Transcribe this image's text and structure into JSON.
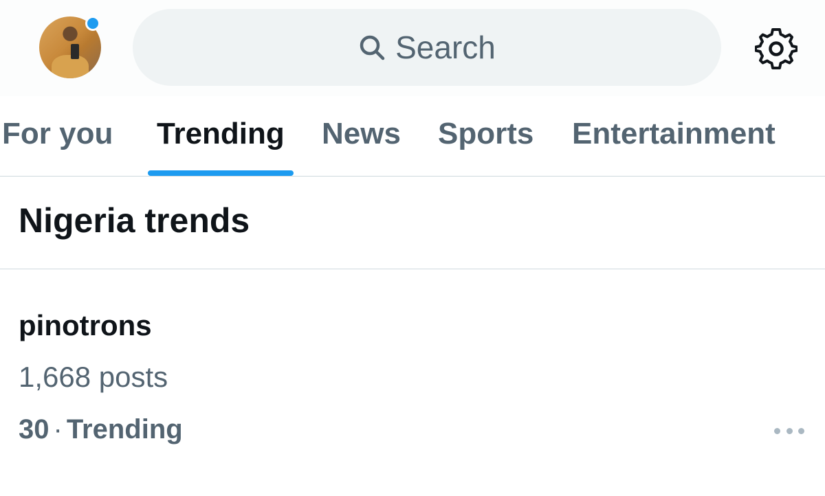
{
  "header": {
    "avatar_has_notification": true,
    "search": {
      "placeholder": "Search",
      "icon": "search-icon"
    },
    "settings_icon": "gear-icon"
  },
  "tabs": [
    {
      "label": "For you",
      "active": false
    },
    {
      "label": "Trending",
      "active": true
    },
    {
      "label": "News",
      "active": false
    },
    {
      "label": "Sports",
      "active": false
    },
    {
      "label": "Entertainment",
      "active": false
    }
  ],
  "section": {
    "title": "Nigeria trends"
  },
  "trends": [
    {
      "name": "pinotrons",
      "count": "1,668 posts",
      "rank": "30",
      "separator": "·",
      "category": "Trending"
    }
  ],
  "colors": {
    "accent": "#1d9bf0",
    "text_primary": "#0f1419",
    "text_secondary": "#536471",
    "search_bg": "#eff3f4"
  }
}
